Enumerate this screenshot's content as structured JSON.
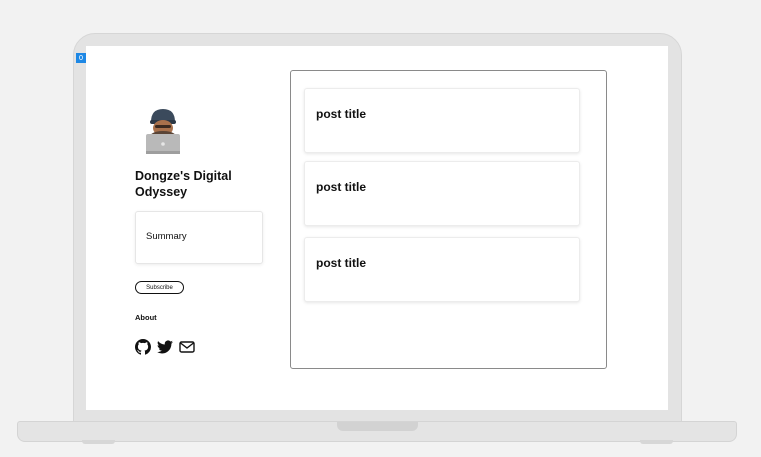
{
  "blog": {
    "title": "Dongze's Digital Odyssey",
    "summary": "Summary",
    "subscribe_label": "Subscribe",
    "about_label": "About",
    "badge_text": "0"
  },
  "social": [
    {
      "icon": "github-icon"
    },
    {
      "icon": "twitter-icon"
    },
    {
      "icon": "mail-icon"
    }
  ],
  "posts": [
    {
      "title": "post title"
    },
    {
      "title": "post title"
    },
    {
      "title": "post title"
    }
  ],
  "colors": {
    "badge": "#1e88e5",
    "frame": "#e3e3e3",
    "text": "#111111"
  }
}
